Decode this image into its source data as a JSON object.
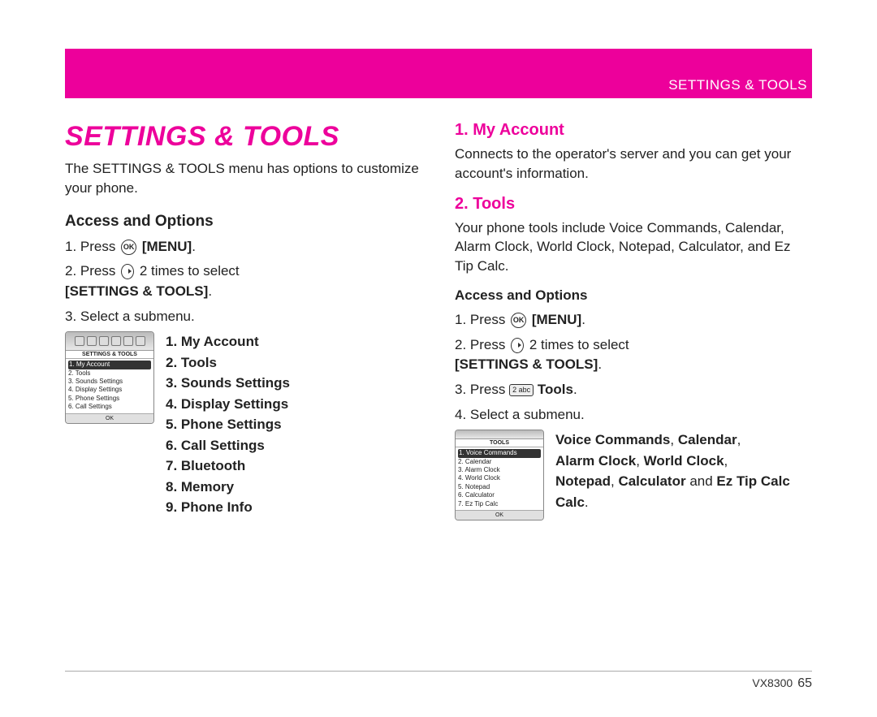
{
  "header": "SETTINGS & TOOLS",
  "main_title": "SETTINGS & TOOLS",
  "intro": "The SETTINGS & TOOLS menu has options to customize your phone.",
  "left": {
    "access_heading": "Access and Options",
    "step1_a": "1. Press ",
    "step1_menu": "[MENU]",
    "step1_b": ".",
    "step2_a": "2. Press ",
    "step2_b": " 2 times to select ",
    "step2_settings": "[SETTINGS & TOOLS]",
    "step2_c": ".",
    "step3": "3. Select a submenu.",
    "screen_title": "SETTINGS & TOOLS",
    "screen_items": [
      "1. My Account",
      "2. Tools",
      "3. Sounds Settings",
      "4. Display Settings",
      "5. Phone Settings",
      "6. Call Settings"
    ],
    "screen_ok": "OK",
    "submenu": [
      "1. My Account",
      "2. Tools",
      "3. Sounds Settings",
      "4. Display Settings",
      "5. Phone Settings",
      "6. Call Settings",
      "7. Bluetooth",
      "8. Memory",
      "9. Phone Info"
    ]
  },
  "right": {
    "h1": "1. My Account",
    "h1_text": "Connects to the operator's server and you can get your account's information.",
    "h2": "2. Tools",
    "h2_text": "Your phone tools include Voice Commands, Calendar, Alarm Clock, World Clock, Notepad, Calculator, and Ez Tip Calc.",
    "access_heading": "Access and Options",
    "step1_a": "1. Press ",
    "step1_menu": "[MENU]",
    "step1_b": ".",
    "step2_a": "2. Press ",
    "step2_b": " 2 times to select ",
    "step2_settings": "[SETTINGS & TOOLS]",
    "step2_c": ".",
    "step3_a": "3. Press ",
    "step3_key": "2 abc",
    "step3_tools": " Tools",
    "step3_b": ".",
    "step4": "4. Select a submenu.",
    "screen_title": "TOOLS",
    "screen_items": [
      "1. Voice Commands",
      "2. Calendar",
      "3. Alarm Clock",
      "4. World Clock",
      "5. Notepad",
      "6. Calculator",
      "7. Ez Tip Calc"
    ],
    "screen_ok": "OK",
    "toolnames": {
      "vc": "Voice Commands",
      "cal": "Calendar",
      "ac": "Alarm Clock",
      "wc": "World Clock",
      "np": "Notepad",
      "calc": "Calculator",
      "and": " and ",
      "etc": "Ez Tip Calc",
      "end": "."
    }
  },
  "footer": {
    "model": "VX8300",
    "page": "65"
  }
}
